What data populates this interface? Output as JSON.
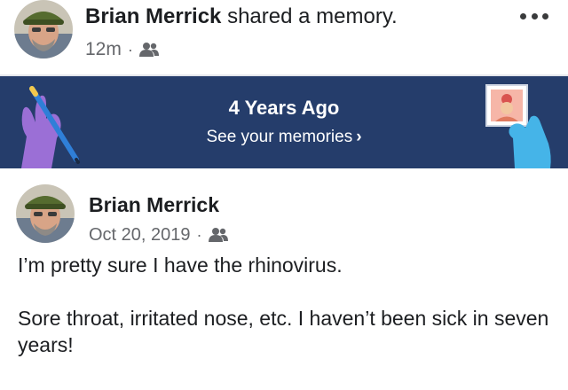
{
  "share_header": {
    "author": "Brian Merrick",
    "action": " shared a memory.",
    "time": "12m",
    "separator": "·",
    "audience_icon": "friends-icon",
    "more_icon": "more-options-icon"
  },
  "banner": {
    "title": "4 Years Ago",
    "link_label": "See your memories",
    "link_chevron": "›",
    "background_color": "#253d6b"
  },
  "post": {
    "author": "Brian Merrick",
    "date": "Oct 20, 2019",
    "separator": "·",
    "audience_icon": "friends-icon",
    "paragraphs": [
      "I’m pretty sure I have the rhinovirus.",
      "Sore throat, irritated nose, etc. I haven’t been sick in seven years!"
    ]
  }
}
